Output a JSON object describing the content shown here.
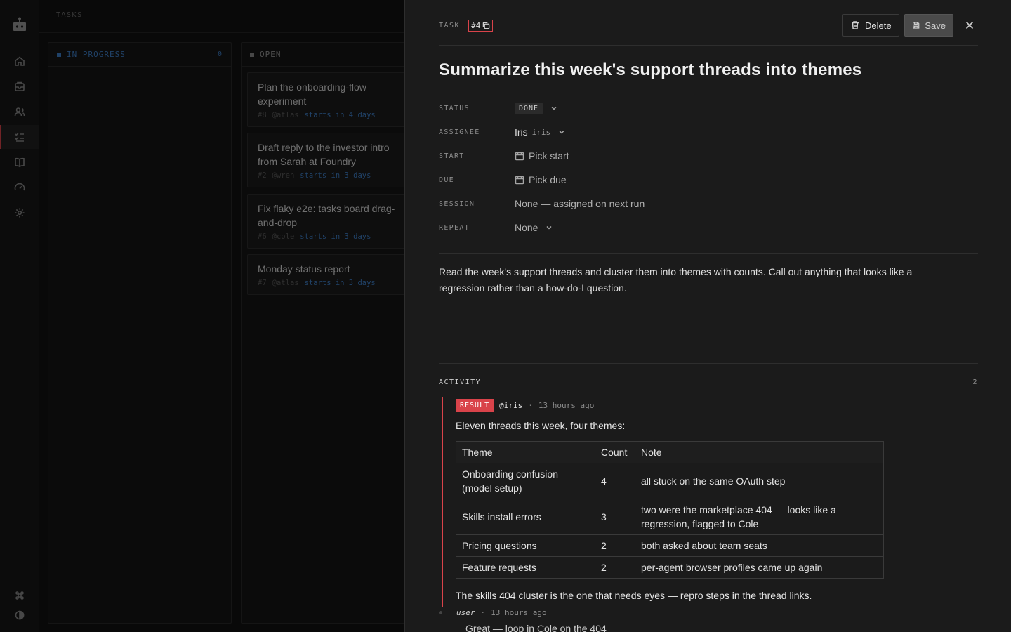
{
  "nav": {
    "items": [
      {
        "icon": "home-icon"
      },
      {
        "icon": "inbox-icon"
      },
      {
        "icon": "users-icon"
      },
      {
        "icon": "tasks-icon",
        "active": true
      },
      {
        "icon": "book-icon"
      },
      {
        "icon": "gauge-icon"
      },
      {
        "icon": "settings-icon"
      }
    ],
    "bottom": [
      {
        "icon": "command-icon"
      },
      {
        "icon": "theme-icon"
      }
    ]
  },
  "board": {
    "header": "TASKS",
    "columns": [
      {
        "name": "IN PROGRESS",
        "count": "0",
        "color": "#3f7fc8",
        "cards": []
      },
      {
        "name": "OPEN",
        "color": "#8a8a8a",
        "cards": [
          {
            "title": "Plan the onboarding-flow experiment",
            "id": "#8",
            "assignee": "@atlas",
            "when": "starts in 4 days"
          },
          {
            "title": "Draft reply to the investor intro from Sarah at Foundry",
            "id": "#2",
            "assignee": "@wren",
            "when": "starts in 3 days"
          },
          {
            "title": "Fix flaky e2e: tasks board drag-and-drop",
            "id": "#6",
            "assignee": "@cole",
            "when": "starts in 3 days"
          },
          {
            "title": "Monday status report",
            "id": "#7",
            "assignee": "@atlas",
            "when": "starts in 3 days"
          }
        ]
      }
    ]
  },
  "task": {
    "label": "TASK",
    "id": "#4",
    "delete_label": "Delete",
    "save_label": "Save",
    "title": "Summarize this week's support threads into themes",
    "props": {
      "status_label": "STATUS",
      "status_value": "DONE",
      "assignee_label": "ASSIGNEE",
      "assignee_name": "Iris",
      "assignee_handle": "iris",
      "start_label": "START",
      "start_value": "Pick start",
      "due_label": "DUE",
      "due_value": "Pick due",
      "session_label": "SESSION",
      "session_value": "None — assigned on next run",
      "repeat_label": "REPEAT",
      "repeat_value": "None"
    },
    "description": "Read the week's support threads and cluster them into themes with counts. Call out anything that looks like a regression rather than a how-do-I question.",
    "activity": {
      "label": "ACTIVITY",
      "count": "2",
      "entries": [
        {
          "badge": "RESULT",
          "user": "@iris",
          "time": "13 hours ago",
          "lead": "Eleven threads this week, four themes:",
          "table": {
            "headers": [
              "Theme",
              "Count",
              "Note"
            ],
            "rows": [
              [
                "Onboarding confusion (model setup)",
                "4",
                "all stuck on the same OAuth step"
              ],
              [
                "Skills install errors",
                "3",
                "two were the marketplace 404 — looks like a regression, flagged to Cole"
              ],
              [
                "Pricing questions",
                "2",
                "both asked about team seats"
              ],
              [
                "Feature requests",
                "2",
                "per-agent browser profiles came up again"
              ]
            ]
          },
          "tail": "The skills 404 cluster is the one that needs eyes — repro steps in the thread links."
        },
        {
          "user": "user",
          "time": "13 hours ago",
          "body": "Great — loop in Cole on the 404"
        }
      ]
    }
  },
  "colors": {
    "accent": "#d9434a",
    "link": "#3f7fc8",
    "panel": "#1b1b1b"
  }
}
